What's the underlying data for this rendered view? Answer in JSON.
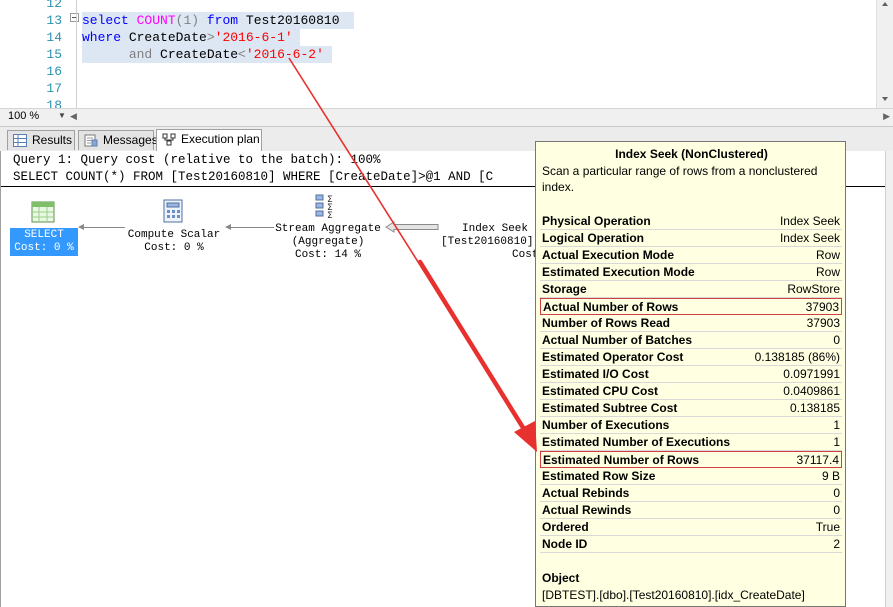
{
  "editor": {
    "line_numbers": [
      "12",
      "13",
      "14",
      "15",
      "16",
      "17",
      "18"
    ],
    "line13": {
      "kw1": "select",
      "fn": "COUNT",
      "paren1": "(1)",
      "kw2": "from",
      "table": "Test20160810"
    },
    "line14": {
      "kw": "where",
      "col": "CreateDate",
      "op": ">",
      "val": "'2016-6-1'"
    },
    "line15": {
      "kw": "and",
      "col": "CreateDate",
      "op": "<",
      "val": "'2016-6-2'"
    }
  },
  "status": {
    "zoom": "100 %"
  },
  "tabs": [
    {
      "label": "Results"
    },
    {
      "label": "Messages"
    },
    {
      "label": "Execution plan"
    }
  ],
  "plan": {
    "query_header": "Query 1: Query cost (relative to the batch): 100%",
    "query_text": "SELECT COUNT(*) FROM [Test20160810] WHERE [CreateDate]>@1 AND [C",
    "operators": [
      {
        "name": "SELECT",
        "cost": "Cost: 0 %"
      },
      {
        "name": "Compute Scalar",
        "cost": "Cost: 0 %"
      },
      {
        "name": "Stream Aggregate",
        "sub": "(Aggregate)",
        "cost": "Cost: 14 %"
      },
      {
        "name": "Index Seek",
        "sub": "[Test20160810]",
        "cost": "Cost"
      }
    ]
  },
  "tooltip": {
    "title": "Index Seek (NonClustered)",
    "description": "Scan a particular range of rows from a nonclustered index.",
    "rows": [
      {
        "k": "Physical Operation",
        "v": "Index Seek"
      },
      {
        "k": "Logical Operation",
        "v": "Index Seek"
      },
      {
        "k": "Actual Execution Mode",
        "v": "Row"
      },
      {
        "k": "Estimated Execution Mode",
        "v": "Row"
      },
      {
        "k": "Storage",
        "v": "RowStore"
      },
      {
        "k": "Actual Number of Rows",
        "v": "37903"
      },
      {
        "k": "Number of Rows Read",
        "v": "37903"
      },
      {
        "k": "Actual Number of Batches",
        "v": "0"
      },
      {
        "k": "Estimated Operator Cost",
        "v": "0.138185 (86%)"
      },
      {
        "k": "Estimated I/O Cost",
        "v": "0.0971991"
      },
      {
        "k": "Estimated CPU Cost",
        "v": "0.0409861"
      },
      {
        "k": "Estimated Subtree Cost",
        "v": "0.138185"
      },
      {
        "k": "Number of Executions",
        "v": "1"
      },
      {
        "k": "Estimated Number of Executions",
        "v": "1"
      },
      {
        "k": "Estimated Number of Rows",
        "v": "37117.4"
      },
      {
        "k": "Estimated Row Size",
        "v": "9 B"
      },
      {
        "k": "Actual Rebinds",
        "v": "0"
      },
      {
        "k": "Actual Rewinds",
        "v": "0"
      },
      {
        "k": "Ordered",
        "v": "True"
      },
      {
        "k": "Node ID",
        "v": "2"
      }
    ],
    "object_label": "Object",
    "object_value": "[DBTEST].[dbo].[Test20160810].[idx_CreateDate]"
  },
  "colors": {
    "annotation_red": "#e8312f",
    "selected_op": "#3399ff",
    "tooltip_bg": "#ffffe1"
  }
}
